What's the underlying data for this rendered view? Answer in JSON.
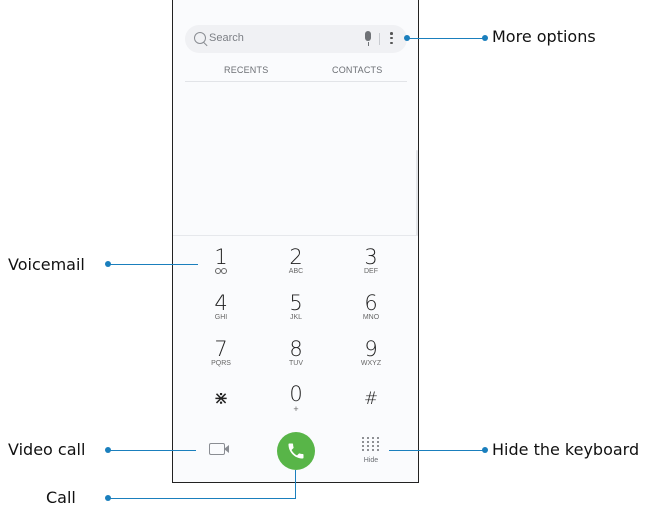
{
  "search": {
    "placeholder": "Search"
  },
  "tabs": [
    {
      "label": "RECENTS"
    },
    {
      "label": "CONTACTS"
    }
  ],
  "keypad": [
    {
      "num": "1",
      "sub": ""
    },
    {
      "num": "2",
      "sub": "ABC"
    },
    {
      "num": "3",
      "sub": "DEF"
    },
    {
      "num": "4",
      "sub": "GHI"
    },
    {
      "num": "5",
      "sub": "JKL"
    },
    {
      "num": "6",
      "sub": "MNO"
    },
    {
      "num": "7",
      "sub": "PQRS"
    },
    {
      "num": "8",
      "sub": "TUV"
    },
    {
      "num": "9",
      "sub": "WXYZ"
    },
    {
      "num": "⋇",
      "sub": ""
    },
    {
      "num": "0",
      "sub": "+"
    },
    {
      "num": "#",
      "sub": ""
    }
  ],
  "bottom": {
    "hide_label": "Hide"
  },
  "callouts": {
    "more_options": "More options",
    "voicemail": "Voicemail",
    "video_call": "Video call",
    "hide_keyboard": "Hide the keyboard",
    "call": "Call"
  },
  "colors": {
    "accent_line": "#1a7fbd",
    "call_green": "#58b548"
  }
}
